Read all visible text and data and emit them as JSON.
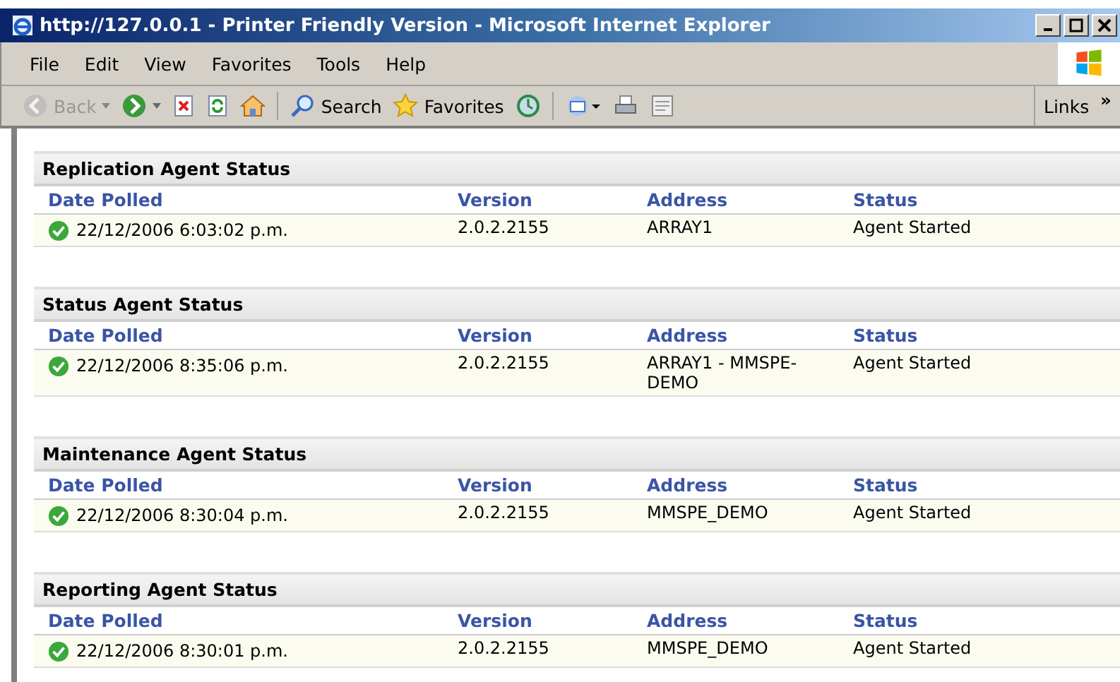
{
  "window": {
    "title": "http://127.0.0.1 - Printer Friendly Version - Microsoft Internet Explorer"
  },
  "menu": [
    "File",
    "Edit",
    "View",
    "Favorites",
    "Tools",
    "Help"
  ],
  "toolbar": [
    {
      "kind": "back",
      "label": "Back",
      "disabled": true
    },
    {
      "kind": "forward",
      "disabled": false
    },
    {
      "kind": "stop",
      "disabled": false
    },
    {
      "kind": "refresh",
      "disabled": false
    },
    {
      "kind": "home",
      "disabled": false
    },
    {
      "kind": "search",
      "label": "Search",
      "disabled": false
    },
    {
      "kind": "favorites",
      "label": "Favorites",
      "disabled": false
    },
    {
      "kind": "media",
      "disabled": false
    },
    {
      "kind": "mail",
      "disabled": false
    },
    {
      "kind": "print",
      "disabled": false
    },
    {
      "kind": "edit",
      "disabled": false
    }
  ],
  "links": {
    "label": "Links",
    "chevron": "»"
  },
  "sections": [
    {
      "title": "Replication Agent Status",
      "columns": [
        "Date Polled",
        "Version",
        "Address",
        "Status"
      ],
      "rows": [
        {
          "date": "22/12/2006 6:03:02 p.m.",
          "version": "2.0.2.2155",
          "address": "ARRAY1",
          "status": "Agent Started"
        }
      ]
    },
    {
      "title": "Status Agent Status",
      "columns": [
        "Date Polled",
        "Version",
        "Address",
        "Status"
      ],
      "rows": [
        {
          "date": "22/12/2006 8:35:06 p.m.",
          "version": "2.0.2.2155",
          "address": "ARRAY1 - MMSPE-DEMO",
          "status": "Agent Started"
        }
      ]
    },
    {
      "title": "Maintenance Agent Status",
      "columns": [
        "Date Polled",
        "Version",
        "Address",
        "Status"
      ],
      "rows": [
        {
          "date": "22/12/2006 8:30:04 p.m.",
          "version": "2.0.2.2155",
          "address": "MMSPE_DEMO",
          "status": "Agent Started"
        }
      ]
    },
    {
      "title": "Reporting Agent Status",
      "columns": [
        "Date Polled",
        "Version",
        "Address",
        "Status"
      ],
      "rows": [
        {
          "date": "22/12/2006 8:30:01 p.m.",
          "version": "2.0.2.2155",
          "address": "MMSPE_DEMO",
          "status": "Agent Started"
        }
      ]
    }
  ]
}
